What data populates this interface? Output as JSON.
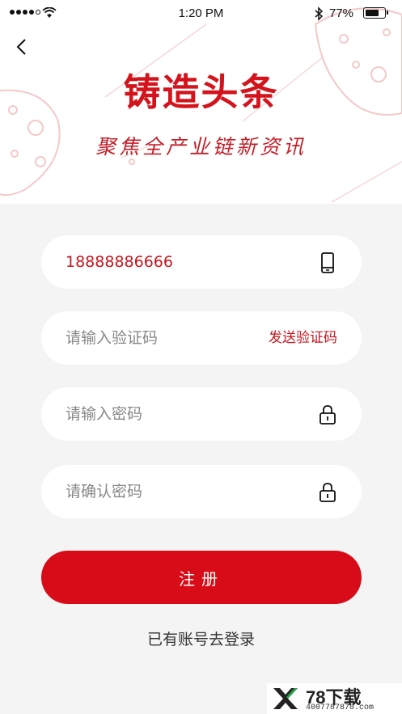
{
  "status_bar": {
    "time": "1:20 PM",
    "battery_pct": "77%",
    "battery_level": 0.77
  },
  "header": {
    "logo_text": "铸造头条",
    "slogan": "聚焦全产业链新资讯"
  },
  "form": {
    "phone_value": "18888886666",
    "code_placeholder": "请输入验证码",
    "send_code_label": "发送验证码",
    "password_placeholder": "请输入密码",
    "confirm_placeholder": "请确认密码",
    "register_label": "注册",
    "login_link": "已有账号去登录"
  },
  "watermark": {
    "brand": "78下载",
    "url": "4007787878.com"
  },
  "colors": {
    "accent": "#d80c18",
    "text_red": "#c8161d",
    "background": "#f4f4f4"
  },
  "icons": [
    "back-chevron-icon",
    "phone-icon",
    "lock-icon",
    "lock-icon",
    "wifi-icon",
    "bluetooth-icon",
    "battery-icon"
  ]
}
